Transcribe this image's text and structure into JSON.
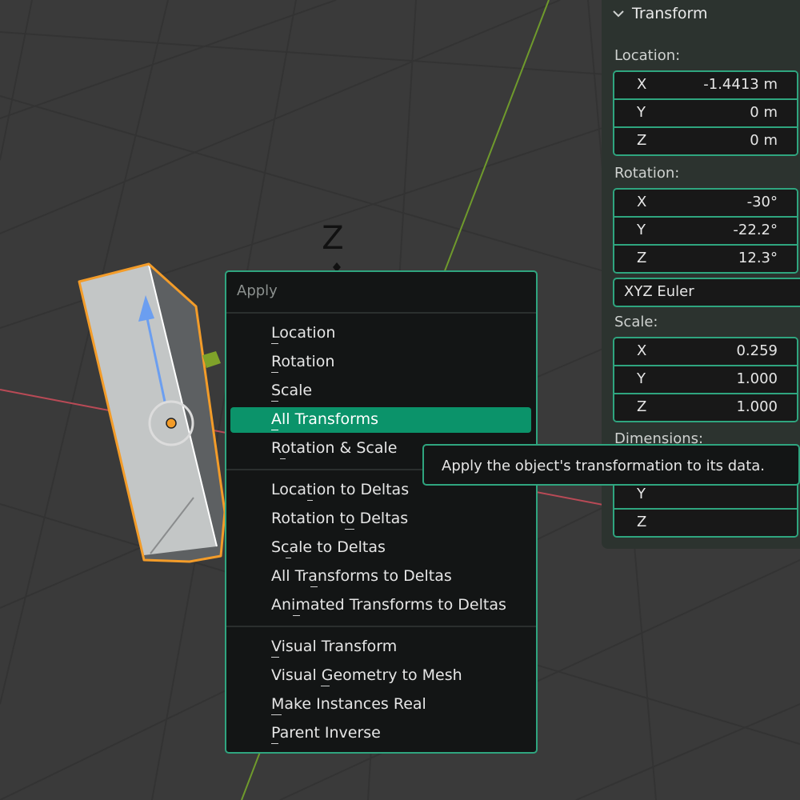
{
  "viewport": {
    "gizmo_axis_label": "Z",
    "colors": {
      "background": "#3a3a3a",
      "grid": "#333333",
      "x_axis": "#b94a56",
      "y_axis": "#6f9a2c",
      "selection_outline": "#f39c29",
      "object_fill": "#c3c6c6",
      "gizmo_arrow": "#6b9ef0"
    }
  },
  "transform_panel": {
    "title": "Transform",
    "location": {
      "label": "Location:",
      "rows": [
        {
          "axis": "X",
          "value": "-1.4413 m"
        },
        {
          "axis": "Y",
          "value": "0 m"
        },
        {
          "axis": "Z",
          "value": "0 m"
        }
      ]
    },
    "rotation": {
      "label": "Rotation:",
      "rows": [
        {
          "axis": "X",
          "value": "-30°"
        },
        {
          "axis": "Y",
          "value": "-22.2°"
        },
        {
          "axis": "Z",
          "value": "12.3°"
        }
      ],
      "mode": "XYZ Euler"
    },
    "scale": {
      "label": "Scale:",
      "rows": [
        {
          "axis": "X",
          "value": "0.259"
        },
        {
          "axis": "Y",
          "value": "1.000"
        },
        {
          "axis": "Z",
          "value": "1.000"
        }
      ]
    },
    "dimensions": {
      "label": "Dimensions:",
      "rows": [
        {
          "axis": "Y",
          "value": ""
        },
        {
          "axis": "Z",
          "value": ""
        }
      ]
    }
  },
  "apply_menu": {
    "title": "Apply",
    "groups": [
      [
        "Location",
        "Rotation",
        "Scale",
        "All Transforms",
        "Rotation & Scale"
      ],
      [
        "Location to Deltas",
        "Rotation to Deltas",
        "Scale to Deltas",
        "All Transforms to Deltas",
        "Animated Transforms to Deltas"
      ],
      [
        "Visual Transform",
        "Visual Geometry to Mesh",
        "Make Instances Real",
        "Parent Inverse"
      ]
    ],
    "active_item": "All Transforms"
  },
  "tooltip": {
    "text": "Apply the object's transformation to its data."
  },
  "colors": {
    "accent": "#2fa57f",
    "highlight": "#0b936a",
    "menu_bg": "#131515",
    "panel_bg": "#2c332f"
  }
}
